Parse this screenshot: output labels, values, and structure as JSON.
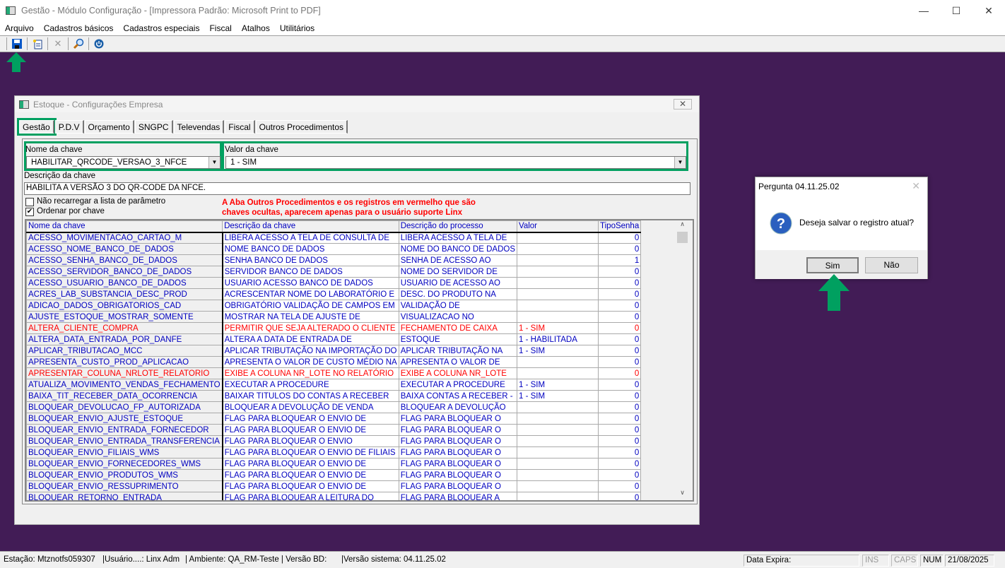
{
  "window": {
    "title": "Gestão  - Módulo Configuração - [Impressora Padrão: Microsoft Print to PDF]"
  },
  "menu": [
    "Arquivo",
    "Cadastros básicos",
    "Cadastros especiais",
    "Fiscal",
    "Atalhos",
    "Utilitários"
  ],
  "toolbar": {
    "icons": [
      "save-icon",
      "new-document-icon",
      "delete-icon",
      "search-icon",
      "power-icon"
    ]
  },
  "child": {
    "title": "Estoque - Configurações Empresa",
    "tabs": [
      "Gestão",
      "P.D.V",
      "Orçamento",
      "SNGPC",
      "Televendas",
      "Fiscal",
      "Outros Procedimentos"
    ],
    "key_name_label": "Nome da chave",
    "key_name_value": "HABILITAR_QRCODE_VERSAO_3_NFCE",
    "key_value_label": "Valor da chave",
    "key_value_value": "1 - SIM",
    "desc_label": "Descrição da chave",
    "desc_value": "HABILITA A VERSÃO 3 DO QR-CODE DA NFCE.",
    "chk_reload": "Não recarregar a lista de parâmetro",
    "chk_reload_checked": false,
    "chk_order": "Ordenar por chave",
    "chk_order_checked": true,
    "notice": [
      "A Aba Outros Procedimentos e os registros em vermelho que são",
      "chaves ocultas, aparecem apenas para o usuário suporte Linx"
    ],
    "columns": [
      "Nome da chave",
      "Descrição  da chave",
      "Descrição do processo",
      "Valor",
      "TipoSenha"
    ],
    "rows": [
      [
        "ACESSO_MOVIMENTACAO_CARTAO_M",
        "LIBERA ACESSO A TELA DE CONSULTA DE",
        "LIBERA ACESSO A TELA DE",
        "",
        "0",
        false
      ],
      [
        "ACESSO_NOME_BANCO_DE_DADOS",
        "NOME BANCO DE DADOS",
        "NOME DO BANCO DE DADOS",
        "",
        "0",
        false
      ],
      [
        "ACESSO_SENHA_BANCO_DE_DADOS",
        "SENHA BANCO DE DADOS",
        "SENHA DE ACESSO AO",
        "",
        "1",
        false
      ],
      [
        "ACESSO_SERVIDOR_BANCO_DE_DADOS",
        "SERVIDOR BANCO DE DADOS",
        "NOME DO SERVIDOR DE",
        "",
        "0",
        false
      ],
      [
        "ACESSO_USUARIO_BANCO_DE_DADOS",
        "USUARIO ACESSO BANCO DE DADOS",
        "USUARIO DE ACESSO AO",
        "",
        "0",
        false
      ],
      [
        "ACRES_LAB_SUBSTANCIA_DESC_PROD",
        "ACRESCENTAR NOME DO LABORATÓRIO E",
        "DESC. DO PRODUTO NA",
        "",
        "0",
        false
      ],
      [
        "ADICAO_DADOS_OBRIGATORIOS_CAD",
        "OBRIGATÓRIO VALIDAÇÃO DE CAMPOS EM",
        " VALIDAÇÃO DE",
        "",
        "0",
        false
      ],
      [
        "AJUSTE_ESTOQUE_MOSTRAR_SOMENTE",
        "MOSTRAR NA TELA DE AJUSTE DE",
        "VISUALIZACAO NO",
        "",
        "0",
        false
      ],
      [
        "ALTERA_CLIENTE_COMPRA",
        "PERMITIR QUE SEJA ALTERADO O CLIENTE",
        "FECHAMENTO DE CAIXA",
        "1 - SIM",
        "0",
        true
      ],
      [
        "ALTERA_DATA_ENTRADA_POR_DANFE",
        "ALTERA A DATA DE ENTRADA DE",
        "ESTOQUE",
        "1 - HABILITADA",
        "0",
        false
      ],
      [
        "APLICAR_TRIBUTACAO_MCC",
        "APLICAR TRIBUTAÇÃO NA IMPORTAÇÃO DO",
        "APLICAR TRIBUTAÇÃO NA",
        "1 - SIM",
        "0",
        false
      ],
      [
        "APRESENTA_CUSTO_PROD_APLICACAO",
        "APRESENTA O VALOR DE CUSTO MÉDIO NA",
        "APRESENTA O VALOR DE",
        "",
        "0",
        false
      ],
      [
        "APRESENTAR_COLUNA_NRLOTE_RELATORIO",
        "EXIBE A COLUNA NR_LOTE NO RELATÓRIO",
        "EXIBE A COLUNA NR_LOTE",
        "",
        "0",
        true
      ],
      [
        "ATUALIZA_MOVIMENTO_VENDAS_FECHAMENTO",
        "EXECUTAR A PROCEDURE",
        "EXECUTAR A PROCEDURE",
        "1 - SIM",
        "0",
        false
      ],
      [
        "BAIXA_TIT_RECEBER_DATA_OCORRENCIA",
        "BAIXAR TITULOS DO CONTAS A RECEBER",
        "BAIXA CONTAS A RECEBER -",
        "1 - SIM",
        "0",
        false
      ],
      [
        "BLOQUEAR_DEVOLUCAO_FP_AUTORIZADA",
        "BLOQUEAR A DEVOLUÇÃO DE VENDA",
        "BLOQUEAR A DEVOLUÇÃO",
        "",
        "0",
        false
      ],
      [
        "BLOQUEAR_ENVIO_AJUSTE_ESTOQUE",
        "FLAG PARA BLOQUEAR O ENVIO DE",
        "FLAG PARA BLOQUEAR O",
        "",
        "0",
        false
      ],
      [
        "BLOQUEAR_ENVIO_ENTRADA_FORNECEDOR",
        "FLAG PARA BLOQUEAR O ENVIO DE",
        "FLAG PARA BLOQUEAR O",
        "",
        "0",
        false
      ],
      [
        "BLOQUEAR_ENVIO_ENTRADA_TRANSFERENCIA",
        "FLAG PARA BLOQUEAR O ENVIO",
        "FLAG PARA BLOQUEAR O",
        "",
        "0",
        false
      ],
      [
        "BLOQUEAR_ENVIO_FILIAIS_WMS",
        "FLAG PARA BLOQUEAR O ENVIO DE FILIAIS",
        "FLAG PARA BLOQUEAR O",
        "",
        "0",
        false
      ],
      [
        "BLOQUEAR_ENVIO_FORNECEDORES_WMS",
        "FLAG PARA BLOQUEAR O ENVIO DE",
        "FLAG PARA BLOQUEAR O",
        "",
        "0",
        false
      ],
      [
        "BLOQUEAR_ENVIO_PRODUTOS_WMS",
        "FLAG PARA BLOQUEAR O ENVIO DE",
        "FLAG PARA BLOQUEAR O",
        "",
        "0",
        false
      ],
      [
        "BLOQUEAR_ENVIO_RESSUPRIMENTO",
        "FLAG PARA BLOQUEAR O ENVIO DE",
        "FLAG PARA BLOQUEAR O",
        "",
        "0",
        false
      ],
      [
        "BLOQUEAR_RETORNO_ENTRADA",
        "FLAG PARA BLOQUEAR A LEITURA DO",
        "FLAG PARA BLOQUEAR A",
        "",
        "0",
        false
      ]
    ]
  },
  "dialog": {
    "title": "Pergunta 04.11.25.02",
    "message": "Deseja salvar o registro atual?",
    "yes": "Sim",
    "no": "Não",
    "icon": "question-icon"
  },
  "status": {
    "station": "Estação: Mtznotfs059307",
    "user": "|Usuário....: Linx Adm",
    "env": "| Ambiente: QA_RM-Teste | Versão BD:",
    "sysver": "|Versão sistema: 04.11.25.02",
    "expira": "Data Expira:",
    "ins": "INS",
    "caps": "CAPS",
    "num": "NUM",
    "date": "21/08/2025"
  },
  "colors": {
    "desktop": "#421c56",
    "highlight": "#00a060",
    "hidden_row": "#ff0000",
    "row_text": "#0000c0"
  }
}
